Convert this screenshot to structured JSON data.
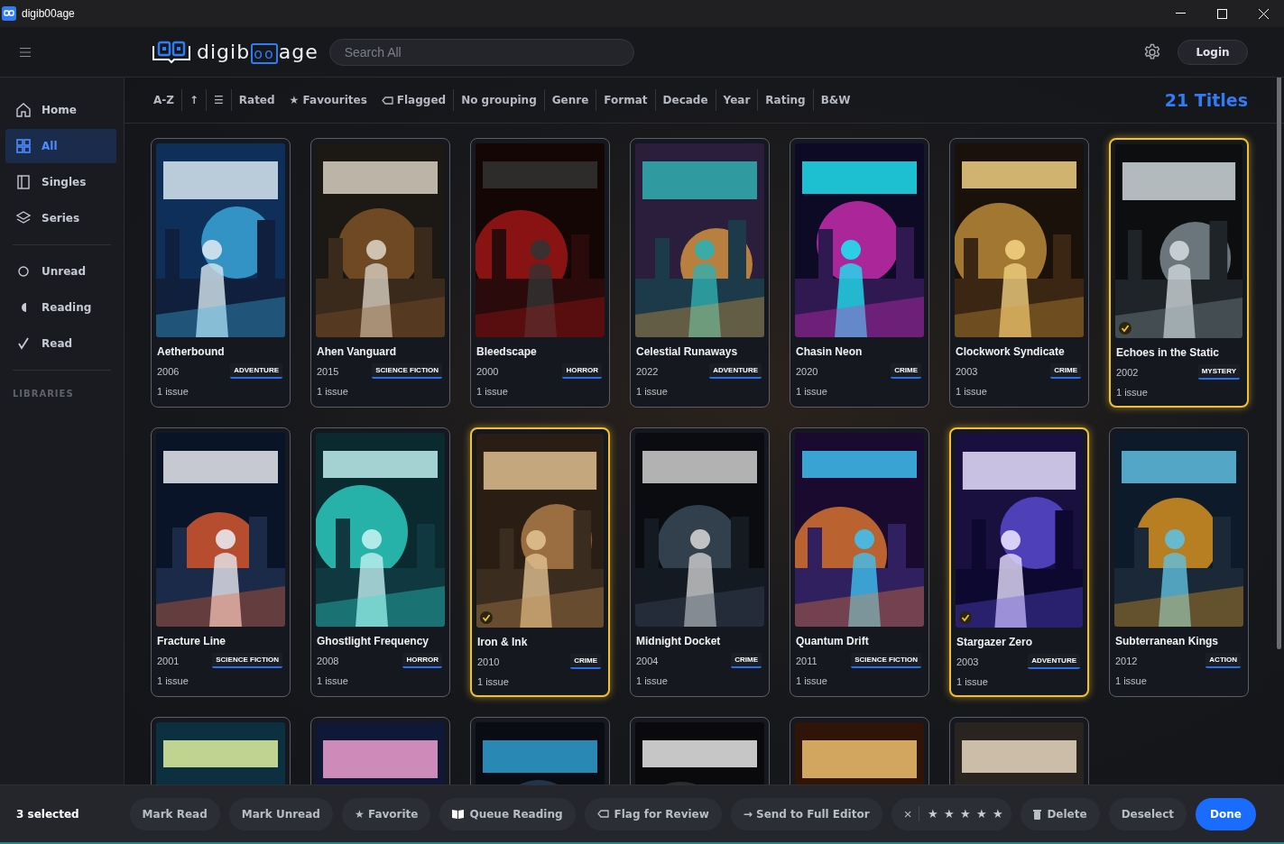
{
  "window": {
    "title": "digib00age"
  },
  "header": {
    "logo": {
      "before": "digib",
      "boxed": "oo",
      "after": "age"
    },
    "search": {
      "placeholder": "Search All"
    },
    "login": "Login"
  },
  "sidebar": {
    "groups": [
      [
        {
          "label": "Home",
          "kind": "home",
          "selected": false
        },
        {
          "label": "All",
          "kind": "grid",
          "selected": true
        },
        {
          "label": "Singles",
          "kind": "single",
          "selected": false
        },
        {
          "label": "Series",
          "kind": "layers",
          "selected": false
        }
      ],
      [
        {
          "label": "Unread",
          "kind": "circle",
          "selected": false
        },
        {
          "label": "Reading",
          "kind": "half",
          "selected": false
        },
        {
          "label": "Read",
          "kind": "check",
          "selected": false
        }
      ]
    ],
    "section_heading": "LIBRARIES"
  },
  "filter_bar": {
    "items": [
      {
        "label": "A-Z",
        "kind": "text",
        "divider": true
      },
      {
        "label": "↑",
        "kind": "text",
        "divider": true
      },
      {
        "label": "☰",
        "kind": "text",
        "divider": true
      },
      {
        "label": "Rated",
        "kind": "text",
        "divider": false
      },
      {
        "label": "★ Favourites",
        "kind": "text",
        "divider": false
      },
      {
        "label": "Flagged",
        "kind": "tag",
        "divider": true
      },
      {
        "label": "No grouping",
        "kind": "text",
        "divider": true
      },
      {
        "label": "Genre",
        "kind": "text",
        "divider": true
      },
      {
        "label": "Format",
        "kind": "text",
        "divider": true
      },
      {
        "label": "Decade",
        "kind": "text",
        "divider": true
      },
      {
        "label": "Year",
        "kind": "text",
        "divider": true
      },
      {
        "label": "Rating",
        "kind": "text",
        "divider": true
      },
      {
        "label": "B&W",
        "kind": "text",
        "divider": false
      }
    ],
    "count": "21 Titles"
  },
  "cards": [
    {
      "title": "Aetherbound",
      "year": "2006",
      "genre": "ADVENTURE",
      "issues": "1 issue",
      "selected": false
    },
    {
      "title": "Ahen Vanguard",
      "year": "2015",
      "genre": "SCIENCE FICTION",
      "issues": "1 issue",
      "selected": false
    },
    {
      "title": "Bleedscape",
      "year": "2000",
      "genre": "HORROR",
      "issues": "1 issue",
      "selected": false
    },
    {
      "title": "Celestial Runaways",
      "year": "2022",
      "genre": "ADVENTURE",
      "issues": "1 issue",
      "selected": false
    },
    {
      "title": "Chasin Neon",
      "year": "2020",
      "genre": "CRIME",
      "issues": "1 issue",
      "selected": false
    },
    {
      "title": "Clockwork Syndicate",
      "year": "2003",
      "genre": "CRIME",
      "issues": "1 issue",
      "selected": false
    },
    {
      "title": "Echoes in the Static",
      "year": "2002",
      "genre": "MYSTERY",
      "issues": "1 issue",
      "selected": true
    },
    {
      "title": "Fracture Line",
      "year": "2001",
      "genre": "SCIENCE FICTION",
      "issues": "1 issue",
      "selected": false
    },
    {
      "title": "Ghostlight Frequency",
      "year": "2008",
      "genre": "HORROR",
      "issues": "1 issue",
      "selected": false
    },
    {
      "title": "Iron & Ink",
      "year": "2010",
      "genre": "CRIME",
      "issues": "1 issue",
      "selected": true
    },
    {
      "title": "Midnight Docket",
      "year": "2004",
      "genre": "CRIME",
      "issues": "1 issue",
      "selected": false
    },
    {
      "title": "Quantum Drift",
      "year": "2011",
      "genre": "SCIENCE FICTION",
      "issues": "1 issue",
      "selected": false
    },
    {
      "title": "Stargazer Zero",
      "year": "2003",
      "genre": "ADVENTURE",
      "issues": "1 issue",
      "selected": true
    },
    {
      "title": "Subterranean Kings",
      "year": "2012",
      "genre": "ACTION",
      "issues": "1 issue",
      "selected": false
    },
    {
      "selected": false
    },
    {
      "selected": false
    },
    {
      "selected": false
    },
    {
      "selected": false
    },
    {
      "selected": false
    },
    {
      "selected": false
    }
  ],
  "action_bar": {
    "selection": "3 selected",
    "buttons": [
      {
        "label": "Mark Read",
        "kind": "plain"
      },
      {
        "label": "Mark Unread",
        "kind": "plain"
      },
      {
        "label": "★ Favorite",
        "kind": "plain"
      },
      {
        "label": "Queue Reading",
        "kind": "book"
      },
      {
        "label": "Flag for Review",
        "kind": "tag"
      },
      {
        "label": "→ Send to Full Editor",
        "kind": "plain"
      },
      {
        "label": "×",
        "kind": "rating"
      },
      {
        "label": "Delete",
        "kind": "trash"
      },
      {
        "label": "Deselect",
        "kind": "plain"
      },
      {
        "label": "Done",
        "kind": "primary"
      }
    ],
    "rating_stars": [
      "★",
      "★",
      "★",
      "★",
      "★"
    ]
  }
}
